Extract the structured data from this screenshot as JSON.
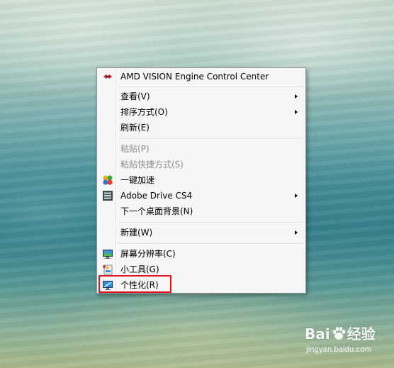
{
  "menu": {
    "items": [
      {
        "id": "amd",
        "label": "AMD VISION Engine Control Center",
        "icon": "amd-icon",
        "disabled": false,
        "submenu": false
      },
      {
        "id": "view",
        "label": "查看(V)",
        "icon": "",
        "disabled": false,
        "submenu": true
      },
      {
        "id": "sort",
        "label": "排序方式(O)",
        "icon": "",
        "disabled": false,
        "submenu": true
      },
      {
        "id": "refresh",
        "label": "刷新(E)",
        "icon": "",
        "disabled": false,
        "submenu": false
      },
      {
        "id": "paste",
        "label": "粘贴(P)",
        "icon": "",
        "disabled": true,
        "submenu": false
      },
      {
        "id": "paste-shortcut",
        "label": "粘贴快捷方式(S)",
        "icon": "",
        "disabled": true,
        "submenu": false
      },
      {
        "id": "speedup",
        "label": "一键加速",
        "icon": "speedup-icon",
        "disabled": false,
        "submenu": false
      },
      {
        "id": "adobe-drive",
        "label": "Adobe Drive CS4",
        "icon": "adobe-drive-icon",
        "disabled": false,
        "submenu": true
      },
      {
        "id": "next-bg",
        "label": "下一个桌面背景(N)",
        "icon": "",
        "disabled": false,
        "submenu": false
      },
      {
        "id": "new",
        "label": "新建(W)",
        "icon": "",
        "disabled": false,
        "submenu": true
      },
      {
        "id": "resolution",
        "label": "屏幕分辨率(C)",
        "icon": "monitor-icon",
        "disabled": false,
        "submenu": false
      },
      {
        "id": "gadgets",
        "label": "小工具(G)",
        "icon": "gadgets-icon",
        "disabled": false,
        "submenu": false
      },
      {
        "id": "personalize",
        "label": "个性化(R)",
        "icon": "personalize-icon",
        "disabled": false,
        "submenu": false
      }
    ]
  },
  "highlight_color": "#e0141a",
  "watermark": {
    "logo_left": "Bai",
    "logo_right": "经验",
    "url": "jingyan.baidu.com"
  }
}
